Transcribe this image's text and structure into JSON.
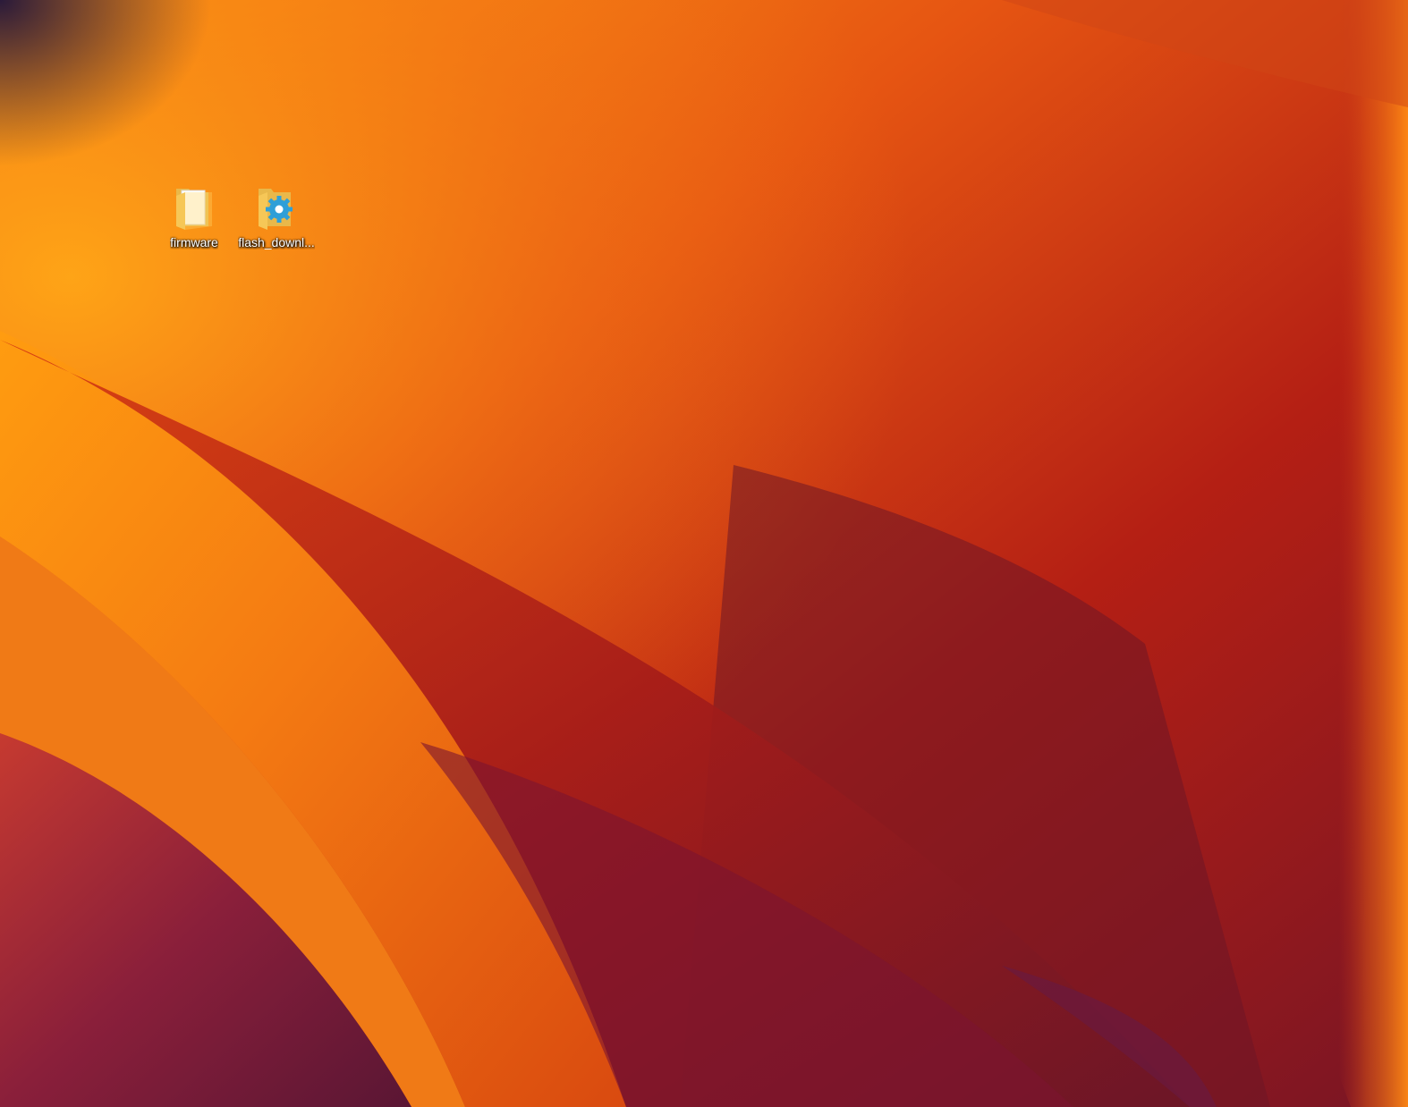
{
  "desktop": {
    "wallpaper": {
      "name": "orange-red-wave-wallpaper",
      "colors": {
        "orange_bright": "#ff9a12",
        "orange": "#f07818",
        "red_orange": "#d8390f",
        "deep_red": "#a81a18",
        "crimson": "#7a1524",
        "plum": "#6e1a3e",
        "dark_corner": "#3a1830"
      }
    },
    "icons": [
      {
        "label": "firmware",
        "icon": "folder-icon"
      },
      {
        "label": "flash_downl...",
        "icon": "folder-gear-icon"
      }
    ]
  }
}
